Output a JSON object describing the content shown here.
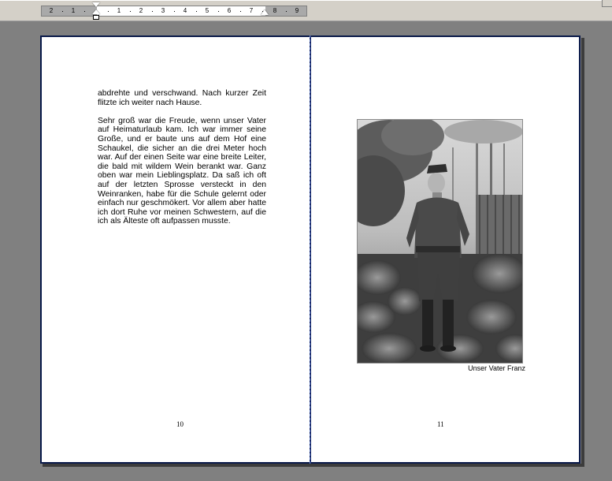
{
  "ruler": {
    "left_labels": [
      "2",
      "1"
    ],
    "labels": [
      "1",
      "2",
      "3",
      "4",
      "5",
      "6",
      "7",
      "8",
      "9"
    ]
  },
  "left_page": {
    "paragraphs": [
      "abdrehte und verschwand. Nach kurzer Zeit flitzte ich weiter nach Hause.",
      "Sehr groß war die Freude, wenn unser Vater auf Heimaturlaub kam. Ich war immer seine Große, und er baute uns auf dem Hof eine Schaukel, die sicher an die drei Meter hoch war. Auf der einen Seite war eine breite Leiter, die bald mit wildem Wein berankt war. Ganz oben war mein Lieblingsplatz. Da saß ich oft auf der letzten Sprosse versteckt in den Weinranken, habe für die Schule gelernt oder einfach nur geschmökert. Vor allem aber hatte ich dort Ruhe vor meinen Schwestern, auf die ich als Älteste oft aufpassen musste."
    ],
    "page_number": "10"
  },
  "right_page": {
    "photo_caption": "Unser Vater Franz",
    "page_number": "11"
  }
}
